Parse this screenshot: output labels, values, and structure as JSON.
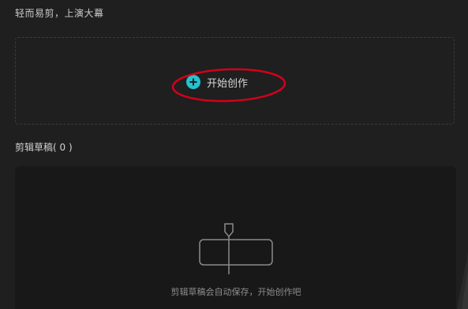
{
  "header": {
    "slogan": "轻而易剪，上演大幕"
  },
  "create": {
    "button_label": "开始创作",
    "icon": "plus-circle-icon",
    "accent_color": "#22c3cf",
    "annotation_color": "#d0021b"
  },
  "drafts": {
    "title": "剪辑草稿( 0 )",
    "empty_icon": "timeline-clip-icon",
    "empty_hint": "剪辑草稿会自动保存，开始创作吧"
  }
}
